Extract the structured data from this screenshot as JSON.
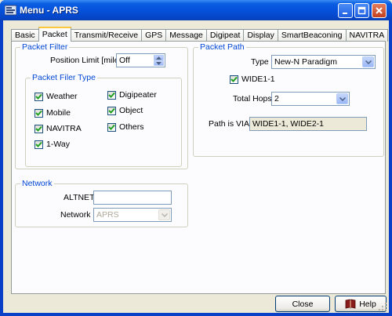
{
  "window": {
    "title": "Menu - APRS",
    "buttons": {
      "minimize": "minimize",
      "maximize": "maximize",
      "close": "close"
    }
  },
  "tabs": [
    {
      "label": "Basic",
      "active": false
    },
    {
      "label": "Packet",
      "active": true
    },
    {
      "label": "Transmit/Receive",
      "active": false
    },
    {
      "label": "GPS",
      "active": false
    },
    {
      "label": "Message",
      "active": false
    },
    {
      "label": "Digipeat",
      "active": false
    },
    {
      "label": "Display",
      "active": false
    },
    {
      "label": "SmartBeaconing",
      "active": false
    },
    {
      "label": "NAVITRA",
      "active": false
    }
  ],
  "packet_filter": {
    "legend": "Packet Filter",
    "position_limit_label": "Position Limit [mile]",
    "position_limit_value": "Off",
    "type_group": {
      "legend": "Packet Filer Type",
      "items": [
        {
          "label": "Weather",
          "checked": true
        },
        {
          "label": "Digipeater",
          "checked": true
        },
        {
          "label": "Mobile",
          "checked": true
        },
        {
          "label": "Object",
          "checked": true
        },
        {
          "label": "NAVITRA",
          "checked": true
        },
        {
          "label": "Others",
          "checked": true
        },
        {
          "label": "1-Way",
          "checked": true
        }
      ]
    }
  },
  "network": {
    "legend": "Network",
    "altnet_label": "ALTNET",
    "altnet_value": "",
    "network_label": "Network",
    "network_value": "APRS"
  },
  "packet_path": {
    "legend": "Packet Path",
    "type_label": "Type",
    "type_value": "New-N Paradigm",
    "wide_label": "WIDE1-1",
    "wide_checked": true,
    "hops_label": "Total Hops",
    "hops_value": "2",
    "path_label": "Path is VIA :",
    "path_value": "WIDE1-1, WIDE2-1"
  },
  "footer": {
    "close_label": "Close",
    "help_label": "Help"
  },
  "colors": {
    "title_bar": "#0552dc",
    "group_legend": "#0046d5",
    "check": "#21a121"
  }
}
